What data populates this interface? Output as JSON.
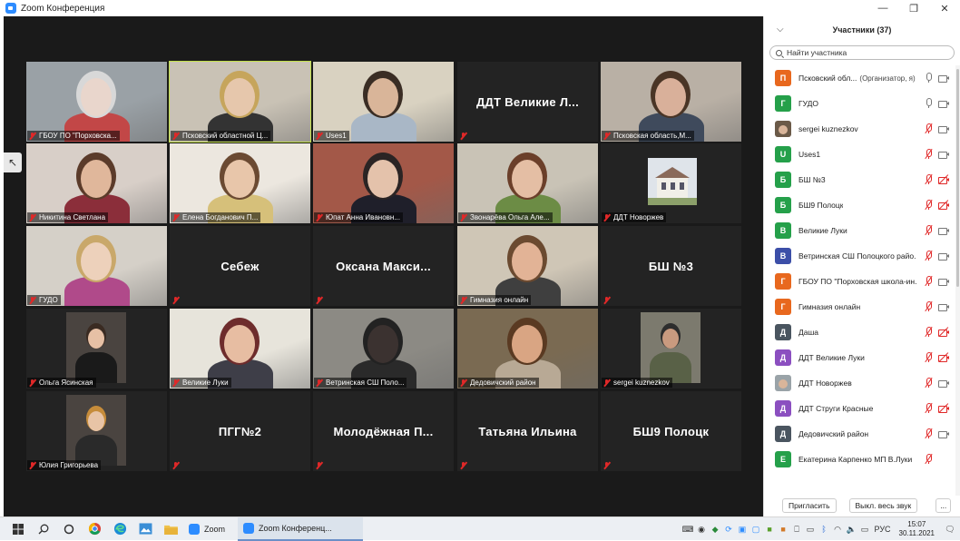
{
  "window": {
    "title": "Zoom Конференция",
    "minimize": "—",
    "maximize": "❐",
    "close": "✕"
  },
  "tiles": [
    {
      "label": "ГБОУ ПО \"Порховска...",
      "name_only": false,
      "active": false,
      "bg": "#9aa1a6",
      "head": "#e9d6cc",
      "hair": "#d8d8d8",
      "shirt": "#c24747"
    },
    {
      "label": "Псковский областной Ц...",
      "name_only": false,
      "active": true,
      "bg": "#c9c2b5",
      "head": "#e6c7ac",
      "hair": "#c6a55c",
      "shirt": "#333333"
    },
    {
      "label": "Uses1",
      "name_only": false,
      "active": false,
      "bg": "#d9d2c1",
      "head": "#d9b599",
      "hair": "#3a2d24",
      "shirt": "#a9b7c6"
    },
    {
      "label": "ДДТ Великие Л...",
      "name_only": true,
      "active": false
    },
    {
      "label": "Псковская область,М...",
      "name_only": false,
      "active": false,
      "bg": "#b9b0a5",
      "head": "#d9b09a",
      "hair": "#4a3526",
      "shirt": "#3f4a5c"
    },
    {
      "label": "Никитина Светлана",
      "name_only": false,
      "active": false,
      "bg": "#d8cfc8",
      "head": "#e0b79b",
      "hair": "#5b3b2a",
      "shirt": "#8b2e3a"
    },
    {
      "label": "Елена Богданович П...",
      "name_only": false,
      "active": false,
      "bg": "#ece7df",
      "head": "#e8c6aa",
      "hair": "#6b4a32",
      "shirt": "#d6c07a"
    },
    {
      "label": "Юпат Анна Ивановн...",
      "name_only": false,
      "active": false,
      "bg": "#a35848",
      "head": "#e4c2ab",
      "hair": "#2b2424",
      "shirt": "#1f1f2a"
    },
    {
      "label": "Звонарёва Ольга Але...",
      "name_only": false,
      "active": false,
      "bg": "#c9c3b6",
      "head": "#e4bea4",
      "hair": "#6b3f2a",
      "shirt": "#6c8c45"
    },
    {
      "label": "ДДТ Новоржев",
      "name_only": false,
      "active": false,
      "bg": "#1f1f1f",
      "building": true
    },
    {
      "label": "ГУДО",
      "name_only": false,
      "active": false,
      "bg": "#d5d0c8",
      "head": "#edd1bb",
      "hair": "#c9a86a",
      "shirt": "#b04a8a"
    },
    {
      "label": "Себеж",
      "name_only": true,
      "active": false
    },
    {
      "label": "Оксана Макси...",
      "name_only": true,
      "active": false
    },
    {
      "label": "Гимназия онлайн",
      "name_only": false,
      "active": false,
      "bg": "#cfc6b6",
      "head": "#e2b396",
      "hair": "#6b4a30",
      "shirt": "#3f3f3f"
    },
    {
      "label": "БШ №3",
      "name_only": true,
      "active": false
    },
    {
      "label": "Ольга Ясинская",
      "name_only": false,
      "active": false,
      "bg": "#232323",
      "head": "#e6c0a5",
      "hair": "#3a2b22",
      "shirt": "#1a1a1a",
      "inset": true
    },
    {
      "label": "Великие Луки",
      "name_only": false,
      "active": false,
      "bg": "#e7e4db",
      "head": "#e7bda2",
      "hair": "#6e2c2c",
      "shirt": "#3e3e48"
    },
    {
      "label": "Ветринская СШ Поло...",
      "name_only": false,
      "active": false,
      "bg": "#8c8a84",
      "head": "#3b3230",
      "hair": "#222222",
      "shirt": "#2a2a2a"
    },
    {
      "label": "Дедовичский район",
      "name_only": false,
      "active": false,
      "bg": "#7a6a52",
      "head": "#d9a583",
      "hair": "#5a3a22",
      "shirt": "#b8a995"
    },
    {
      "label": "sergei kuznezkov",
      "name_only": false,
      "active": false,
      "bg": "#232323",
      "head": "#c99a7f",
      "hair": "#2d2d2d",
      "shirt": "#596147",
      "inset": true
    },
    {
      "label": "Юлия Григорьева",
      "name_only": false,
      "active": false,
      "bg": "#232323",
      "head": "#e8c4a6",
      "hair": "#c68c3a",
      "shirt": "#2a2a2a",
      "inset": true
    },
    {
      "label": "ПГГ№2",
      "name_only": true,
      "active": false
    },
    {
      "label": "Молодёжная П...",
      "name_only": true,
      "active": false
    },
    {
      "label": "Татьяна Ильина",
      "name_only": true,
      "active": false
    },
    {
      "label": "БШ9 Полоцк",
      "name_only": true,
      "active": false
    }
  ],
  "panel": {
    "title": "Участники (37)",
    "search_placeholder": "Найти участника",
    "invite": "Пригласить",
    "mute_all": "Выкл. весь звук",
    "more": "..."
  },
  "participants": [
    {
      "initial": "П",
      "color": "#e8681e",
      "name": "Псковский обл...",
      "tag": "(Организатор, я)",
      "mic": "on",
      "cam": "on"
    },
    {
      "initial": "Г",
      "color": "#25a04a",
      "name": "ГУДО",
      "tag": "",
      "mic": "on",
      "cam": "on"
    },
    {
      "initial": "",
      "color": "#6b5a48",
      "name": "sergei kuznezkov",
      "tag": "",
      "mic": "off",
      "cam": "on",
      "photo": true
    },
    {
      "initial": "U",
      "color": "#25a04a",
      "name": "Uses1",
      "tag": "",
      "mic": "off",
      "cam": "on"
    },
    {
      "initial": "Б",
      "color": "#25a04a",
      "name": "БШ №3",
      "tag": "",
      "mic": "off",
      "cam": "off"
    },
    {
      "initial": "Б",
      "color": "#25a04a",
      "name": "БШ9 Полоцк",
      "tag": "",
      "mic": "off",
      "cam": "off"
    },
    {
      "initial": "В",
      "color": "#25a04a",
      "name": "Великие Луки",
      "tag": "",
      "mic": "off",
      "cam": "on"
    },
    {
      "initial": "В",
      "color": "#3c4fa8",
      "name": "Ветринская СШ Полоцкого райо...",
      "tag": "",
      "mic": "off",
      "cam": "on"
    },
    {
      "initial": "Г",
      "color": "#e8681e",
      "name": "ГБОУ ПО \"Порховская школа-ин...",
      "tag": "",
      "mic": "off",
      "cam": "on"
    },
    {
      "initial": "Г",
      "color": "#e8681e",
      "name": "Гимназия онлайн",
      "tag": "",
      "mic": "off",
      "cam": "on"
    },
    {
      "initial": "Д",
      "color": "#4a5560",
      "name": "Даша",
      "tag": "",
      "mic": "off",
      "cam": "off"
    },
    {
      "initial": "Д",
      "color": "#8b4fc0",
      "name": "ДДТ Великие Луки",
      "tag": "",
      "mic": "off",
      "cam": "off"
    },
    {
      "initial": "",
      "color": "#9aa3a8",
      "name": "ДДТ Новоржев",
      "tag": "",
      "mic": "off",
      "cam": "on",
      "photo": true
    },
    {
      "initial": "Д",
      "color": "#8b4fc0",
      "name": "ДДТ Струги Красные",
      "tag": "",
      "mic": "off",
      "cam": "off"
    },
    {
      "initial": "Д",
      "color": "#4a5560",
      "name": "Дедовичский район",
      "tag": "",
      "mic": "off",
      "cam": "on"
    },
    {
      "initial": "Е",
      "color": "#25a04a",
      "name": "Екатерина Карпенко МП В.Луки",
      "tag": "",
      "mic": "off",
      "cam": "none"
    }
  ],
  "taskbar": {
    "apps": [
      {
        "label": "Zoom",
        "active": false
      },
      {
        "label": "Zoom Конференц...",
        "active": true
      }
    ],
    "lang": "РУС",
    "time": "15:07",
    "date": "30.11.2021"
  }
}
